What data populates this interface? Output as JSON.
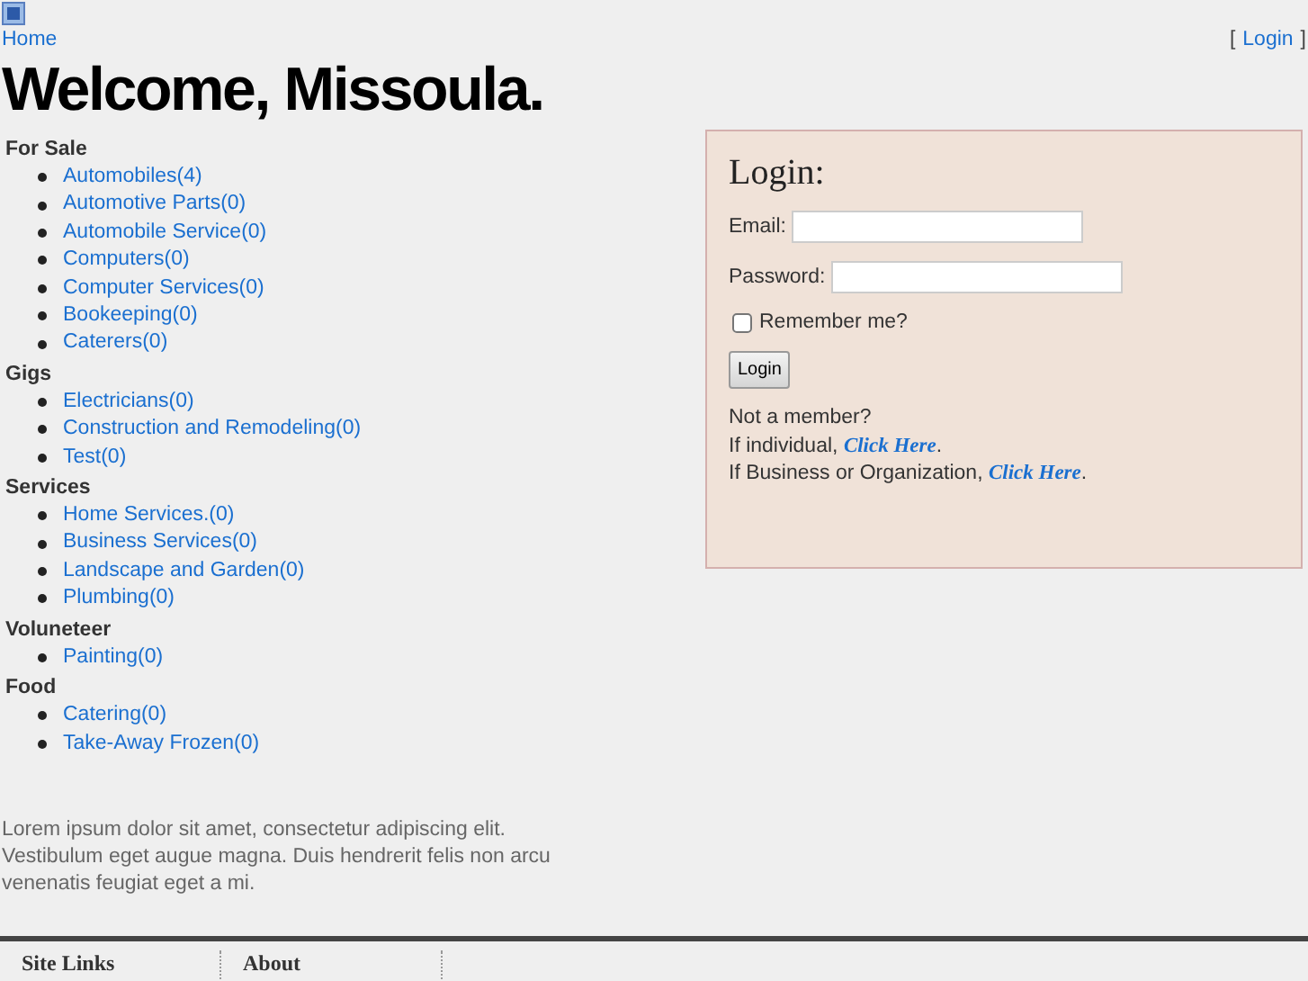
{
  "breadcrumb": "Home",
  "login_link": {
    "open": "[",
    "label": "Login",
    "close": "]"
  },
  "heading": "Welcome, Missoula.",
  "categories": [
    {
      "name": "For Sale",
      "items": [
        "Automobiles(4)",
        "Automotive Parts(0)",
        "Automobile Service(0)",
        "Computers(0)",
        "Computer Services(0)",
        "Bookeeping(0)",
        "Caterers(0)"
      ]
    },
    {
      "name": "Gigs",
      "items": [
        "Electricians(0)",
        "Construction and Remodeling(0)",
        "Test(0)"
      ]
    },
    {
      "name": "Services",
      "items": [
        "Home Services.(0)",
        "Business Services(0)",
        "Landscape and Garden(0)",
        "Plumbing(0)"
      ]
    },
    {
      "name": "Voluneteer",
      "items": [
        "Painting(0)"
      ]
    },
    {
      "name": "Food",
      "items": [
        "Catering(0)",
        "Take-Away Frozen(0)"
      ]
    }
  ],
  "intro": "Lorem ipsum dolor sit amet, consectetur adipiscing elit. Vestibulum eget augue magna. Duis hendrerit felis non arcu venenatis feugiat eget a mi.",
  "login": {
    "title": "Login:",
    "fields": [
      {
        "label": "Email:"
      },
      {
        "label": "Password:"
      }
    ],
    "remember": {
      "label": "Remember me?",
      "checked": false
    },
    "button": "Login",
    "not_member": "Not a member?",
    "signup_lines": [
      {
        "prefix": "If individual, ",
        "link": "Click Here",
        "suffix": "."
      },
      {
        "prefix": "If Business or Organization, ",
        "link": "Click Here",
        "suffix": "."
      }
    ]
  },
  "footer": [
    "Site Links",
    "About"
  ]
}
